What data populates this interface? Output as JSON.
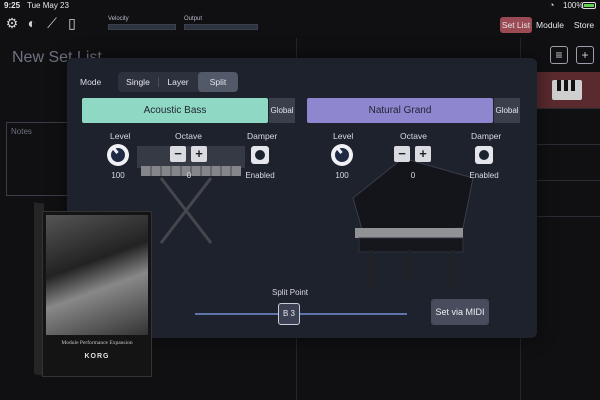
{
  "status": {
    "time": "9:25",
    "date": "Tue May 23",
    "battery": "100%"
  },
  "toolbar": {
    "velocity_label": "Velocity",
    "output_label": "Output",
    "set_list": "Set List",
    "module": "Module",
    "store": "Store"
  },
  "background": {
    "title": "New Set List",
    "notes": "Notes"
  },
  "panel": {
    "mode_label": "Mode",
    "modes": [
      "Single",
      "Layer",
      "Split"
    ],
    "selected_mode": "Split",
    "parts": [
      {
        "name": "Acoustic Bass",
        "color": "#8fd9c4",
        "global": "Global",
        "level_label": "Level",
        "level_value": "100",
        "octave_label": "Octave",
        "octave_value": "0",
        "damper_label": "Damper",
        "damper_value": "Enabled"
      },
      {
        "name": "Natural Grand",
        "color": "#8e86cf",
        "global": "Global",
        "level_label": "Level",
        "level_value": "100",
        "octave_label": "Octave",
        "octave_value": "0",
        "damper_label": "Damper",
        "damper_value": "Enabled"
      }
    ],
    "split_point_label": "Split Point",
    "split_point_value": "B 3",
    "set_via_midi": "Set via MIDI"
  },
  "product": {
    "caption": "Module Performance Expansion",
    "logo": "KORG"
  },
  "colors": {
    "accent_active": "#9a4a52",
    "slider": "#5f74a8"
  }
}
